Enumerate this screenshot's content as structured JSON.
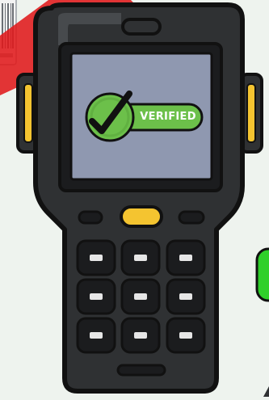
{
  "screen": {
    "badge": {
      "label": "VERIFIED",
      "icon": "checkmark-icon"
    }
  },
  "colors": {
    "background": "#eef3ee",
    "device_body": "#2f3133",
    "outline": "#111111",
    "screen": "#8f98b0",
    "badge_green": "#6cc04a",
    "scan_beam": "#e0191b",
    "accent_yellow": "#f4c430",
    "key_face": "#e6e6e6"
  }
}
